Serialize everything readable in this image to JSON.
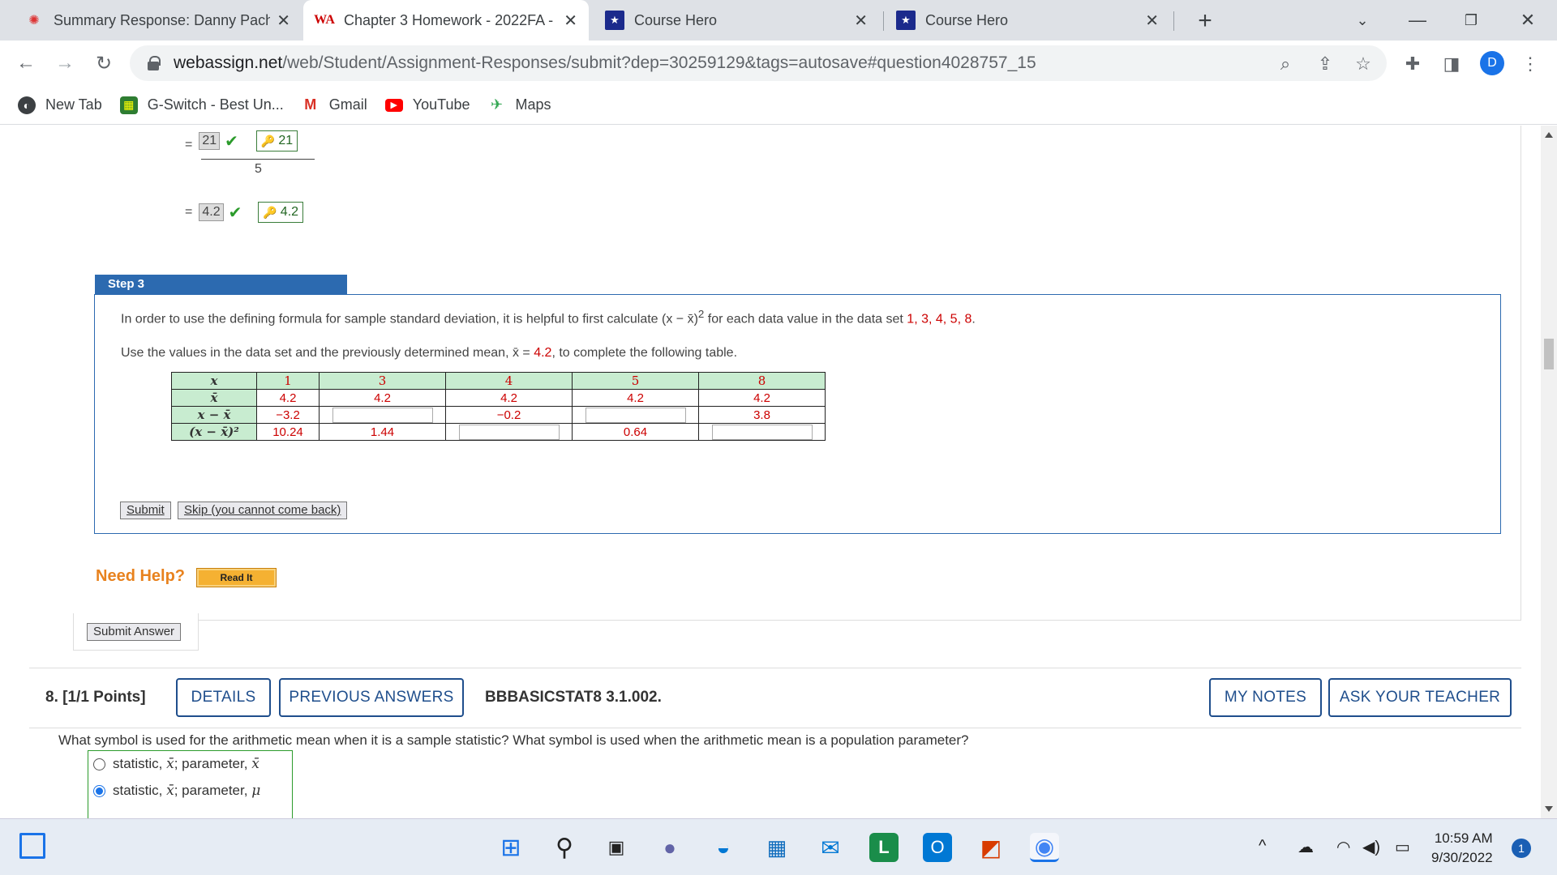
{
  "browser": {
    "tabs": [
      {
        "title": "Summary Response: Danny Pacho",
        "icon": "gear-red-icon"
      },
      {
        "title": "Chapter 3 Homework - 2022FA -",
        "icon": "webassign-icon"
      },
      {
        "title": "Course Hero",
        "icon": "coursehero-icon"
      },
      {
        "title": "Course Hero",
        "icon": "coursehero-icon"
      }
    ],
    "url_host": "webassign.net",
    "url_path": "/web/Student/Assignment-Responses/submit?dep=30259129&tags=autosave#question4028757_15",
    "profile_initial": "D",
    "bookmarks": [
      "New Tab",
      "G-Switch - Best Un...",
      "Gmail",
      "YouTube",
      "Maps"
    ]
  },
  "prev_step": {
    "eq": "=",
    "numerator_answer": "21",
    "numerator_key": "21",
    "denominator": "5",
    "result_answer": "4.2",
    "result_key": "4.2"
  },
  "step3": {
    "title": "Step 3",
    "p1_a": "In order to use the defining formula for sample standard deviation, it is helpful to first calculate (x − x̄)",
    "p1_sup": "2",
    "p1_b": " for each data value in the data set ",
    "p1_values": "1, 3, 4, 5, 8",
    "p1_end": ".",
    "p2_a": "Use the values in the data set and the previously determined mean, ",
    "p2_mean_sym": "x̄ = ",
    "p2_mean": "4.2",
    "p2_end": ", to complete the following table.",
    "table": {
      "row_headers": [
        "x",
        "x̄",
        "x − x̄",
        "(x − x̄)²"
      ],
      "x": [
        "1",
        "3",
        "4",
        "5",
        "8"
      ],
      "xbar": [
        "4.2",
        "4.2",
        "4.2",
        "4.2",
        "4.2"
      ],
      "diff": [
        "−3.2",
        "",
        "−0.2",
        "",
        "3.8"
      ],
      "sq": [
        "10.24",
        "1.44",
        "",
        "0.64",
        ""
      ]
    },
    "submit_label": "Submit",
    "skip_label": "Skip (you cannot come back)"
  },
  "help": {
    "need_help": "Need Help?",
    "read_it": "Read It"
  },
  "submit_answer": "Submit Answer",
  "q8": {
    "number": "8.",
    "points": "[1/1 Points]",
    "details": "DETAILS",
    "previous_answers": "PREVIOUS ANSWERS",
    "code": "BBBASICSTAT8 3.1.002.",
    "my_notes": "MY NOTES",
    "ask_teacher": "ASK YOUR TEACHER",
    "question": "What symbol is used for the arithmetic mean when it is a sample statistic? What symbol is used when the arithmetic mean is a population parameter?",
    "choices": [
      {
        "label_a": "statistic, ",
        "sym_a": "x̄",
        "label_b": "; parameter, ",
        "sym_b": "x̄",
        "selected": false
      },
      {
        "label_a": "statistic, ",
        "sym_a": "x̄",
        "label_b": "; parameter, ",
        "sym_b": "μ",
        "selected": true
      }
    ]
  },
  "taskbar": {
    "time": "10:59 AM",
    "date": "9/30/2022",
    "notifications": "1"
  },
  "colors": {
    "accent_blue": "#2c6ab0",
    "answer_red": "#cc0000",
    "help_orange": "#e8821e",
    "button_navy": "#1f4e8c"
  }
}
